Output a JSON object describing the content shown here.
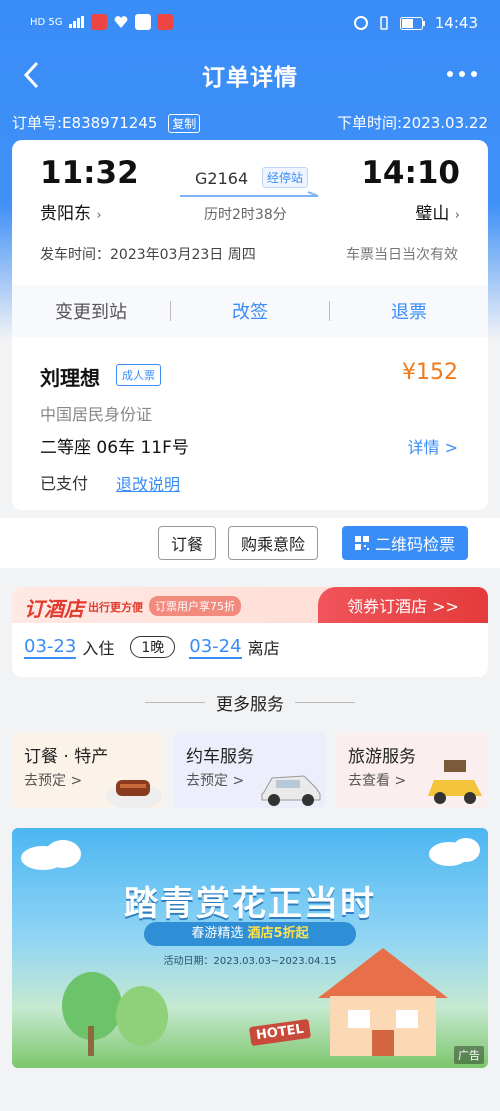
{
  "status_bar": {
    "left_text": "HD 5G",
    "time": "14:43"
  },
  "nav": {
    "title": "订单详情",
    "back_icon": "chevron-left-icon",
    "more_icon": "more-dots-icon"
  },
  "order": {
    "number_label": "订单号:E838971245",
    "copy_label": "复制",
    "order_time_label": "下单时间:2023.03.22"
  },
  "trip": {
    "depart_time": "11:32",
    "depart_station": "贵阳东",
    "arrive_time": "14:10",
    "arrive_station": "璧山",
    "train_no": "G2164",
    "via_label": "经停站",
    "duration": "历时2时38分",
    "depart_date": "发车时间：2023年03月23日 周四",
    "validity": "车票当日当次有效"
  },
  "actions": {
    "change_station": "变更到站",
    "reschedule": "改签",
    "refund": "退票"
  },
  "passenger": {
    "name": "刘理想",
    "ticket_type": "成人票",
    "price": "¥152",
    "id_type": "中国居民身份证",
    "seat": "二等座 06车 11F号",
    "detail": "详情 >",
    "pay_status": "已支付",
    "rule_link": "退改说明"
  },
  "buttons": {
    "meal": "订餐",
    "insurance": "购乘意险",
    "qr_check": "二维码检票"
  },
  "hotel": {
    "logo": "订酒店",
    "slogan": "出行更方便",
    "badge": "订票用户享75折",
    "coupon": "领券订酒店 >>",
    "checkin_date": "03-23",
    "checkin_label": "入住",
    "nights": "1晚",
    "checkout_date": "03-24",
    "checkout_label": "离店"
  },
  "more_services": {
    "title": "更多服务",
    "items": [
      {
        "title": "订餐 · 特产",
        "sub": "去预定 >"
      },
      {
        "title": "约车服务",
        "sub": "去预定 >"
      },
      {
        "title": "旅游服务",
        "sub": "去查看 >"
      }
    ]
  },
  "ad": {
    "headline": "踏青赏花正当时",
    "sub_prefix": "春游精选",
    "sub_highlight": "酒店5折起",
    "dates": "活动日期：2023.03.03~2023.04.15",
    "tag": "广告",
    "sign": "HOTEL"
  },
  "colors": {
    "primary": "#3a8cf7",
    "price": "#f07a1a",
    "hotel_red": "#e23b2e"
  }
}
